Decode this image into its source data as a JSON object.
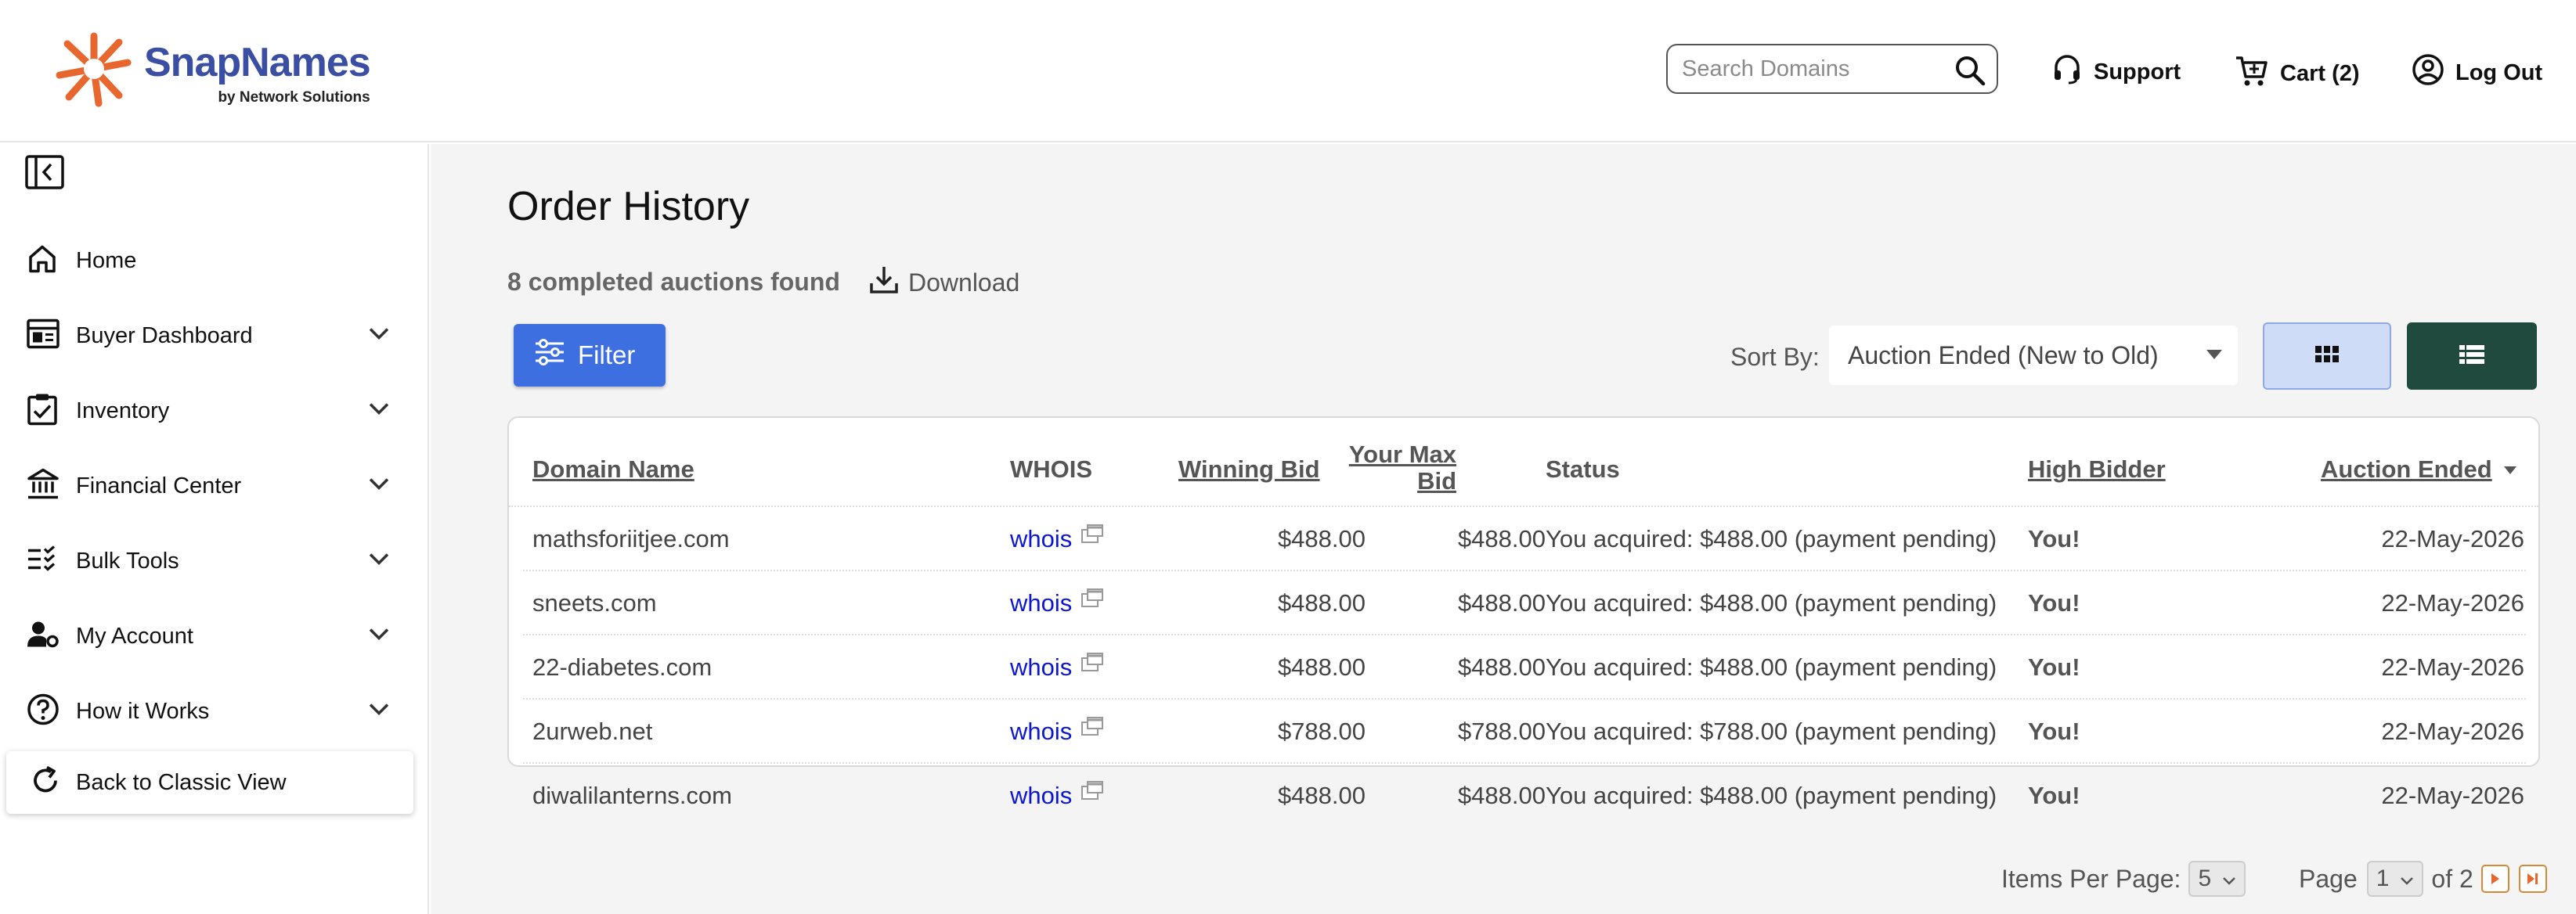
{
  "brand": {
    "name": "SnapNames",
    "sub": "by Network Solutions",
    "accent": "#e8672f",
    "text_color": "#3a4ea3"
  },
  "header": {
    "search_placeholder": "Search Domains",
    "support": "Support",
    "cart": "Cart (2)",
    "logout": "Log Out"
  },
  "sidebar": {
    "items": [
      {
        "label": "Home",
        "icon": "home-icon"
      },
      {
        "label": "Buyer Dashboard",
        "icon": "dashboard-icon"
      },
      {
        "label": "Inventory",
        "icon": "clipboard-icon"
      },
      {
        "label": "Financial Center",
        "icon": "bank-icon"
      },
      {
        "label": "Bulk Tools",
        "icon": "checklist-icon"
      },
      {
        "label": "My Account",
        "icon": "user-gear-icon"
      },
      {
        "label": "How it Works",
        "icon": "help-icon"
      }
    ],
    "classic": "Back to Classic View"
  },
  "main": {
    "title": "Order History",
    "count": "8 completed auctions found",
    "download": "Download",
    "filter": "Filter",
    "sort_label": "Sort By:",
    "sort_value": "Auction Ended (New to Old)",
    "list_view_color": "#1f4a3d",
    "filter_color": "#3d6fe0"
  },
  "table": {
    "headers": {
      "domain": "Domain Name",
      "whois": "WHOIS",
      "winning": "Winning Bid",
      "maxbid_1": "Your Max",
      "maxbid_2": "Bid",
      "status": "Status",
      "bidder": "High Bidder",
      "ended": "Auction Ended"
    },
    "rows": [
      {
        "domain": "mathsforiitjee.com",
        "whois": "whois",
        "winning": "$488.00",
        "max": "$488.00",
        "status": "You acquired: $488.00 (payment pending)",
        "bidder": "You!",
        "ended": "22-May-2026"
      },
      {
        "domain": "sneets.com",
        "whois": "whois",
        "winning": "$488.00",
        "max": "$488.00",
        "status": "You acquired: $488.00 (payment pending)",
        "bidder": "You!",
        "ended": "22-May-2026"
      },
      {
        "domain": "22-diabetes.com",
        "whois": "whois",
        "winning": "$488.00",
        "max": "$488.00",
        "status": "You acquired: $488.00 (payment pending)",
        "bidder": "You!",
        "ended": "22-May-2026"
      },
      {
        "domain": "2urweb.net",
        "whois": "whois",
        "winning": "$788.00",
        "max": "$788.00",
        "status": "You acquired: $788.00 (payment pending)",
        "bidder": "You!",
        "ended": "22-May-2026"
      },
      {
        "domain": "diwalilanterns.com",
        "whois": "whois",
        "winning": "$488.00",
        "max": "$488.00",
        "status": "You acquired: $488.00 (payment pending)",
        "bidder": "You!",
        "ended": "22-May-2026"
      }
    ]
  },
  "pagination": {
    "items_label": "Items Per Page:",
    "items_value": "5",
    "page_label": "Page",
    "page_value": "1",
    "of_label": "of 2"
  }
}
